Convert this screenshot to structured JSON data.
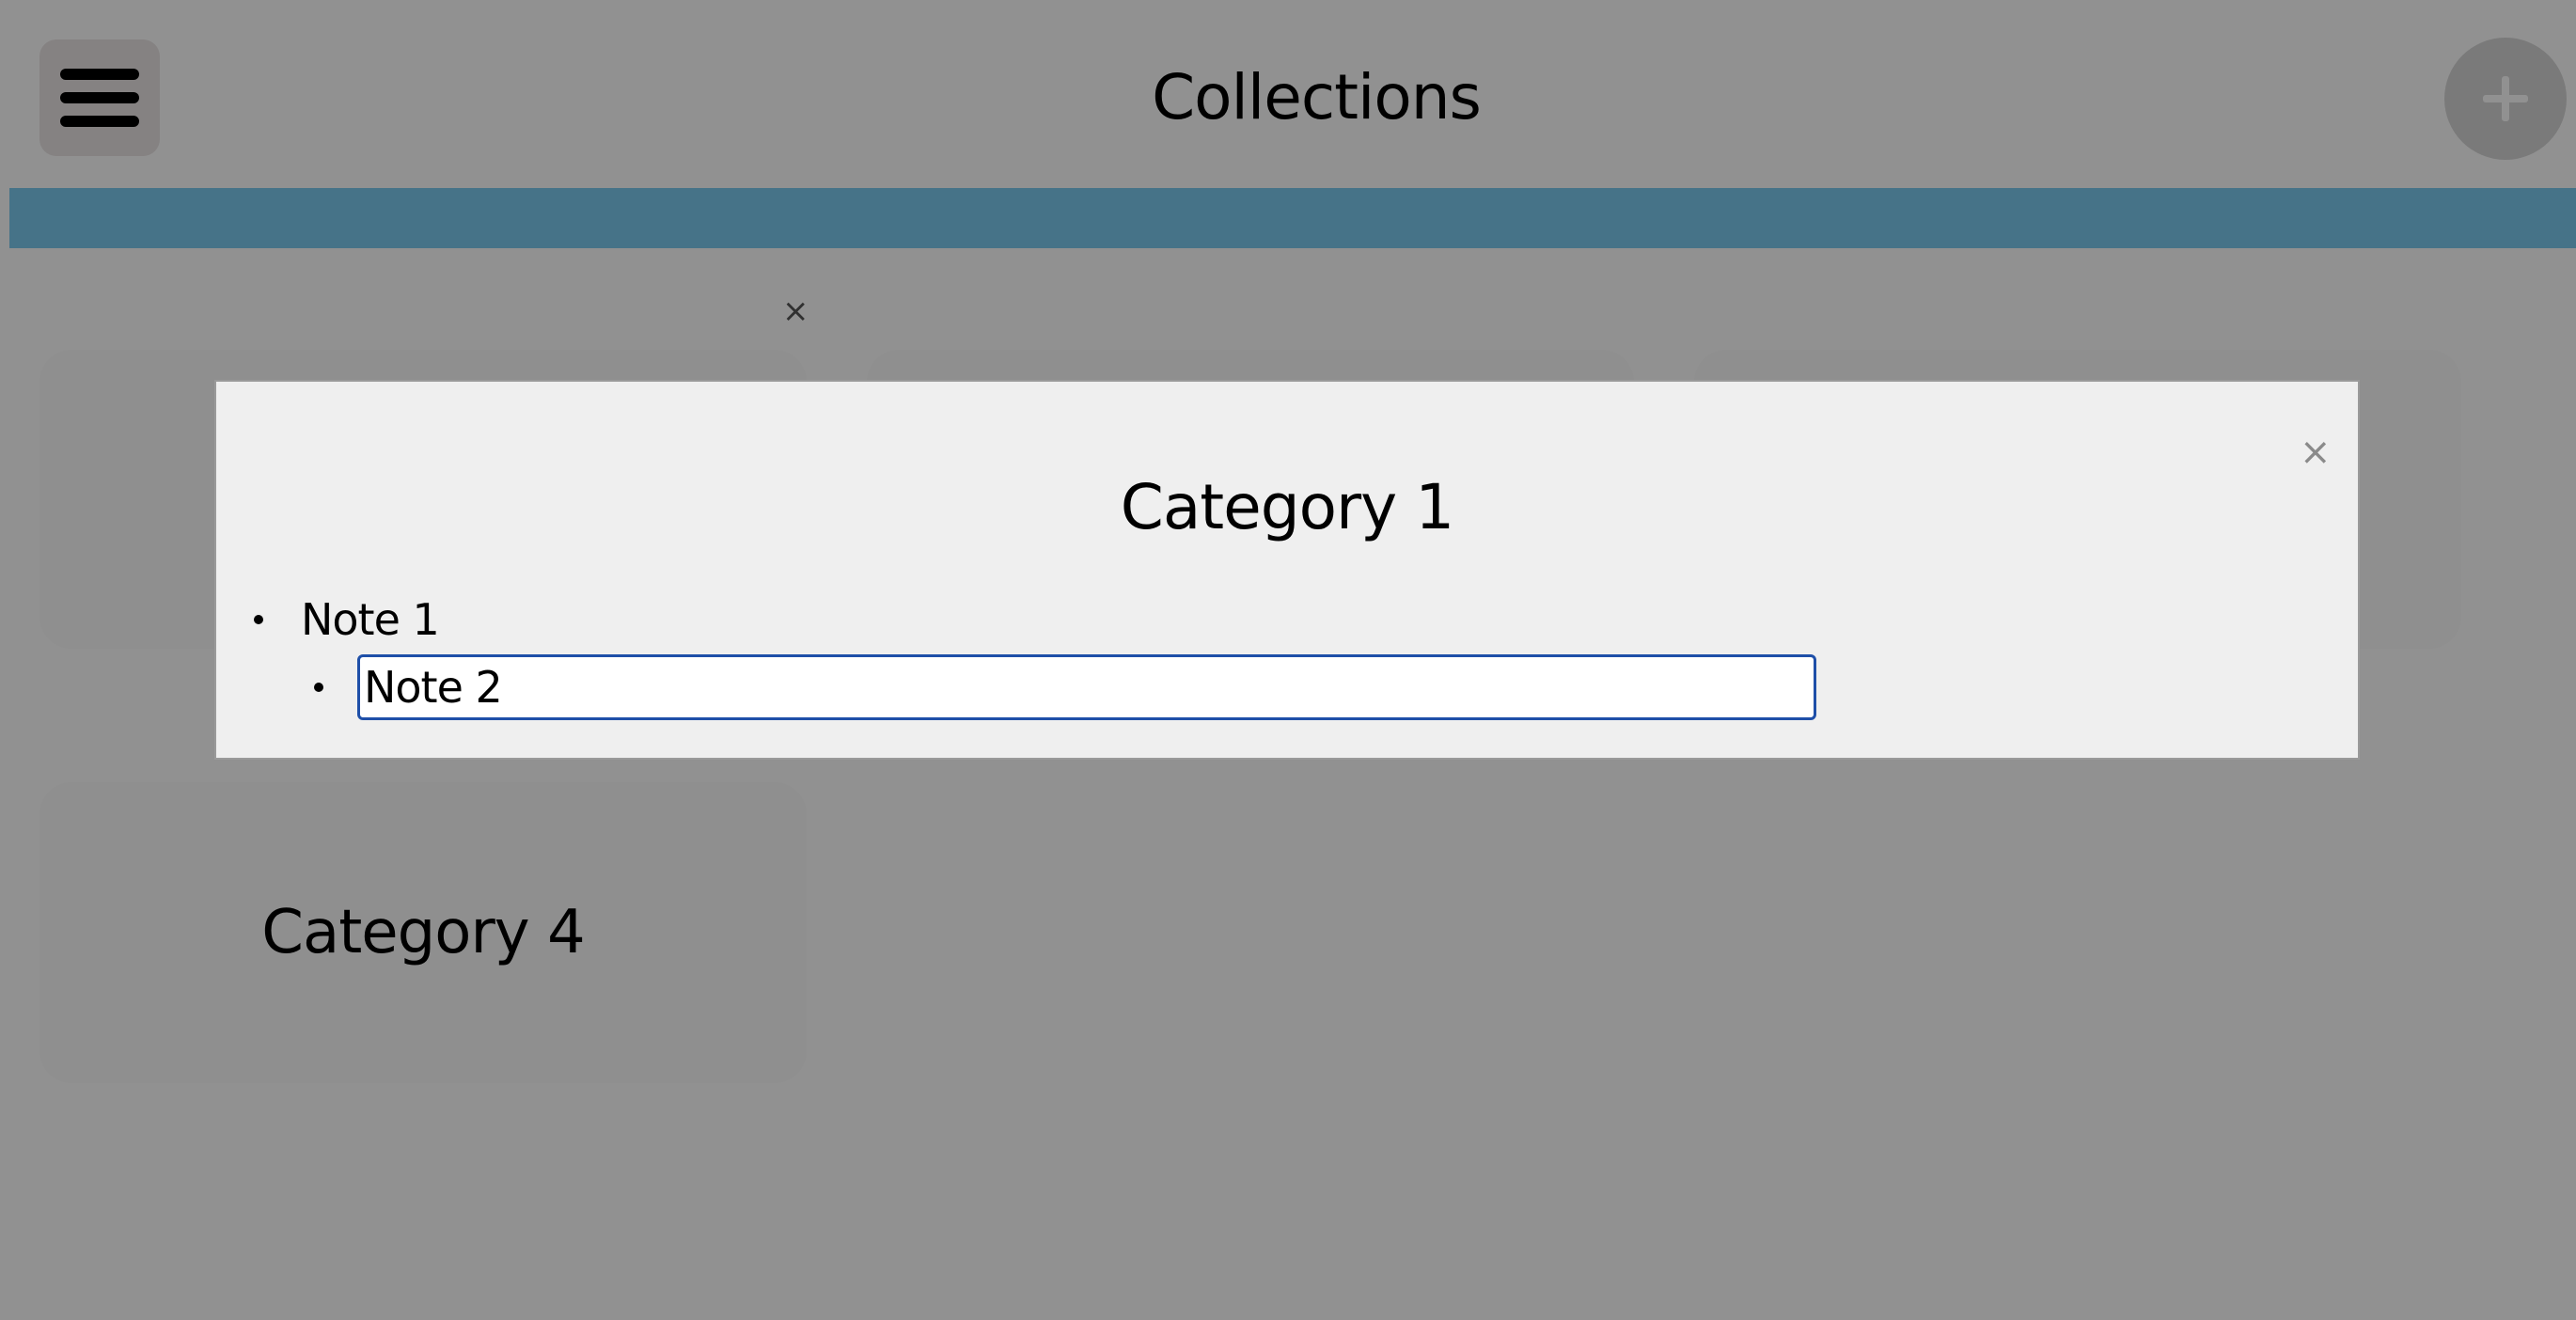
{
  "header": {
    "title": "Collections",
    "menu_icon": "hamburger-menu-icon",
    "add_icon": "plus-icon"
  },
  "colors": {
    "accent_bar": "#7bcbf0",
    "menu_button_bg": "#eae4e4",
    "input_border": "#1e4fa8"
  },
  "cards": [
    {
      "title": ""
    },
    {
      "title": ""
    },
    {
      "title": ""
    },
    {
      "title": "Category 4"
    }
  ],
  "card_delete_label": "×",
  "modal": {
    "title": "Category 1",
    "close_label": "×",
    "notes": [
      {
        "text": "Note 1"
      }
    ],
    "editing_note_value": "Note 2"
  }
}
